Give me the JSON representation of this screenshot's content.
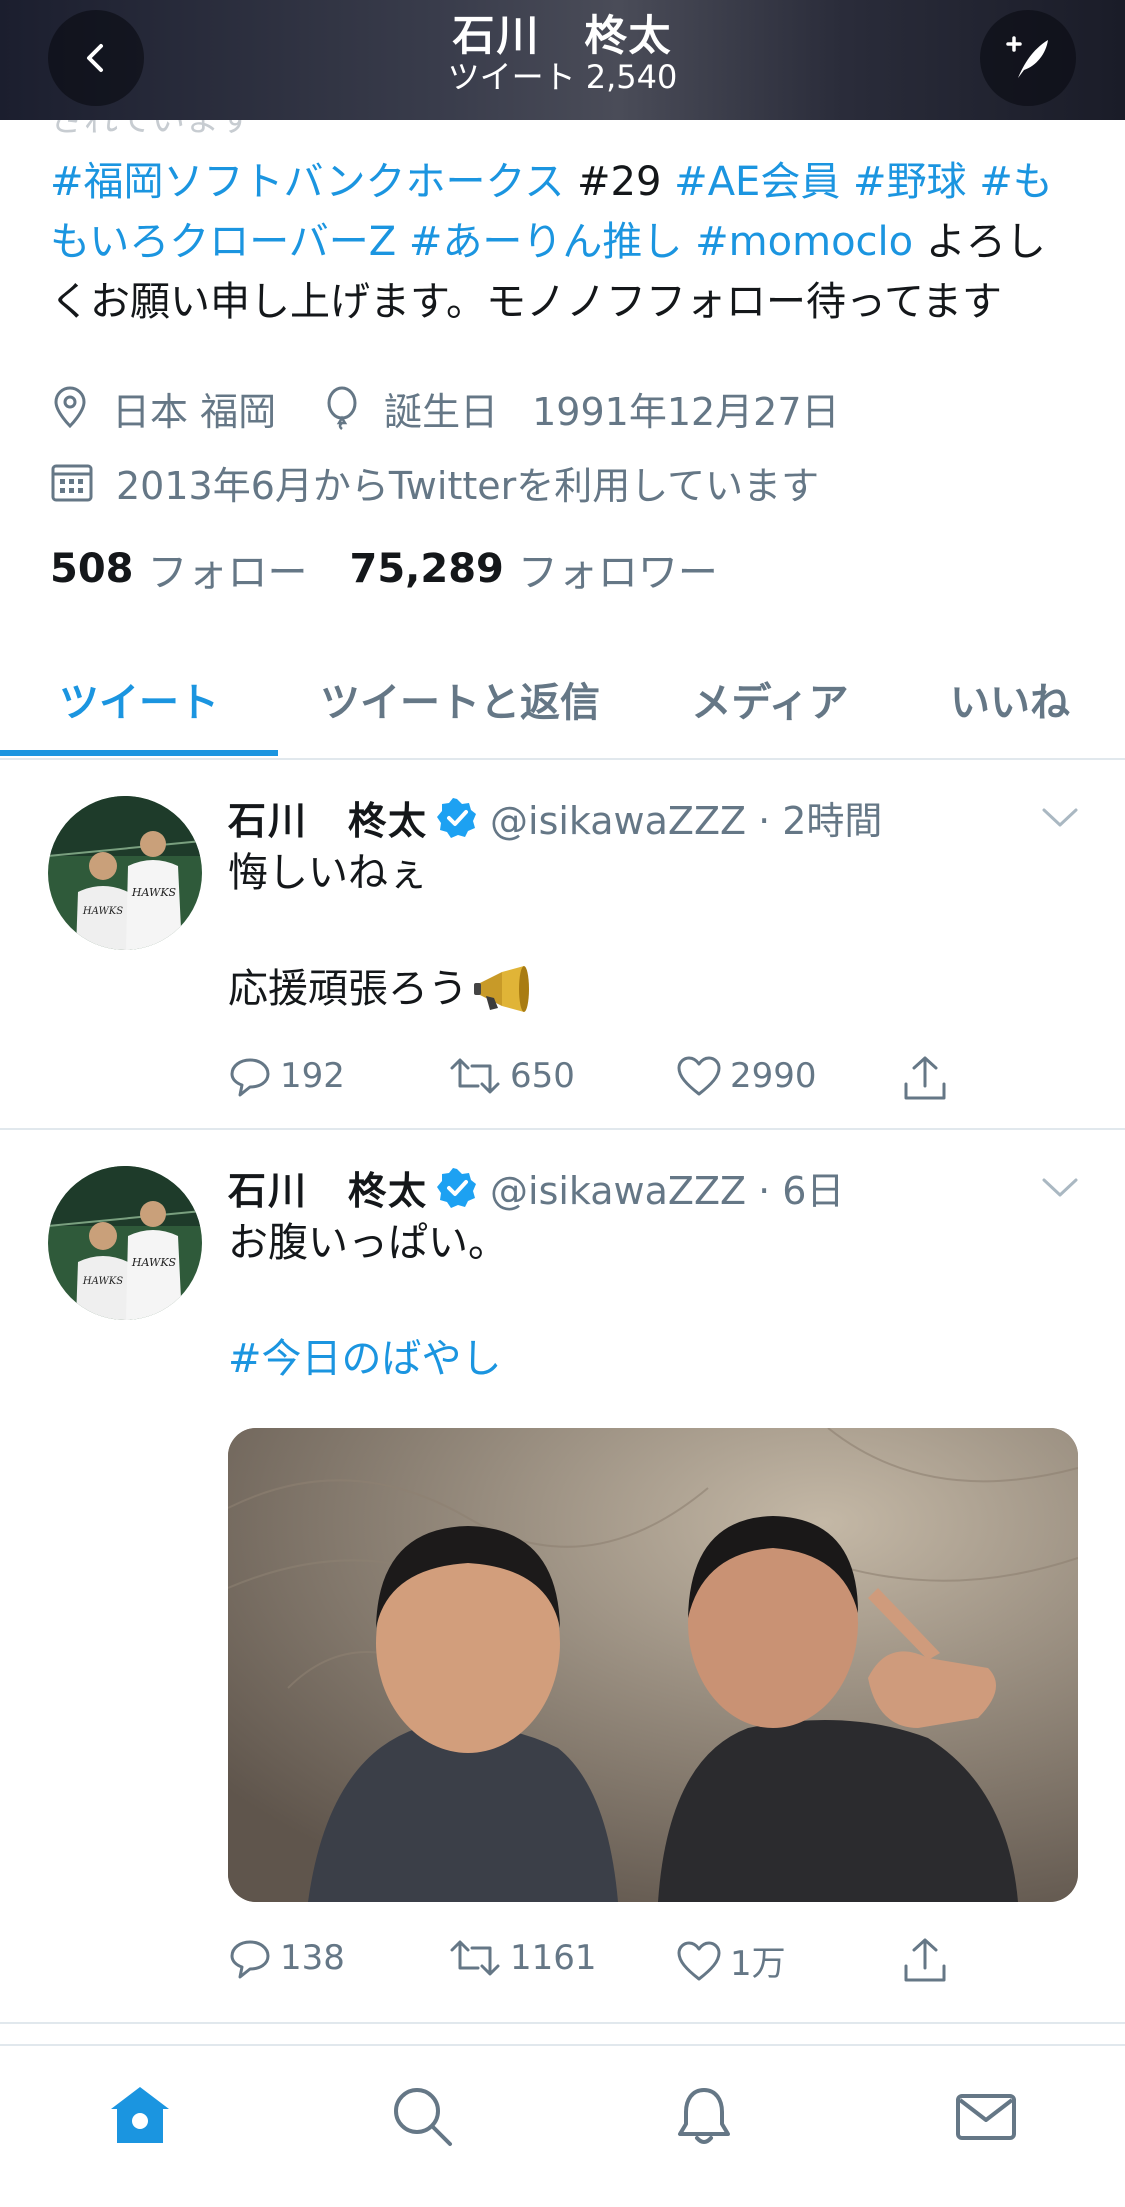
{
  "header": {
    "title": "石川　柊太",
    "subtitle": "ツイート 2,540"
  },
  "profile": {
    "cut_text": "されています",
    "bio_line1_tags": "#福岡ソフトバンクホークス",
    "bio_line1_rest": " #29 ",
    "bio_line1_tag2": "#AE会員",
    "bio_line1_tag3": "#野球",
    "bio_line1_tag4": "#も",
    "bio_line2_tag1": "もいろクローバーZ",
    "bio_line2_tag2": "#あーりん推し",
    "bio_line2_tag3": "#momoclo",
    "bio_line2_rest": " よろし",
    "bio_line3": "くお願い申し上げます。モノノフフォロー待ってます",
    "location": "日本 福岡",
    "birthday_label": "誕生日",
    "birthday": "1991年12月27日",
    "joined": "2013年6月からTwitterを利用しています",
    "following_count": "508",
    "following_label": "フォロー",
    "followers_count": "75,289",
    "followers_label": "フォロワー"
  },
  "tabs": [
    "ツイート",
    "ツイートと返信",
    "メディア",
    "いいね"
  ],
  "tweets": [
    {
      "name": "石川　柊太",
      "handle": "@isikawaZZZ · 2時間",
      "line1": "悔しいねぇ",
      "line2": "応援頑張ろう",
      "replies": "192",
      "retweets": "650",
      "likes": "2990"
    },
    {
      "name": "石川　柊太",
      "handle": "@isikawaZZZ · 6日",
      "line1": "お腹いっぱい。",
      "hashtag": "#今日のばやし",
      "replies": "138",
      "retweets": "1161",
      "likes": "1万"
    }
  ],
  "colors": {
    "accent": "#1b95e0",
    "text": "#14171a",
    "secondary": "#657786",
    "divider": "#e1e8ed",
    "verified": "#1da1f2"
  },
  "icons": {
    "back": "chevron-left-icon",
    "compose": "compose-feather-icon",
    "location": "location-pin-icon",
    "birthday": "balloon-icon",
    "calendar": "calendar-icon",
    "verified": "verified-badge-icon",
    "reply": "reply-icon",
    "retweet": "retweet-icon",
    "like": "heart-icon",
    "share": "share-icon",
    "home": "home-icon",
    "search": "search-icon",
    "notifications": "bell-icon",
    "messages": "mail-icon"
  }
}
